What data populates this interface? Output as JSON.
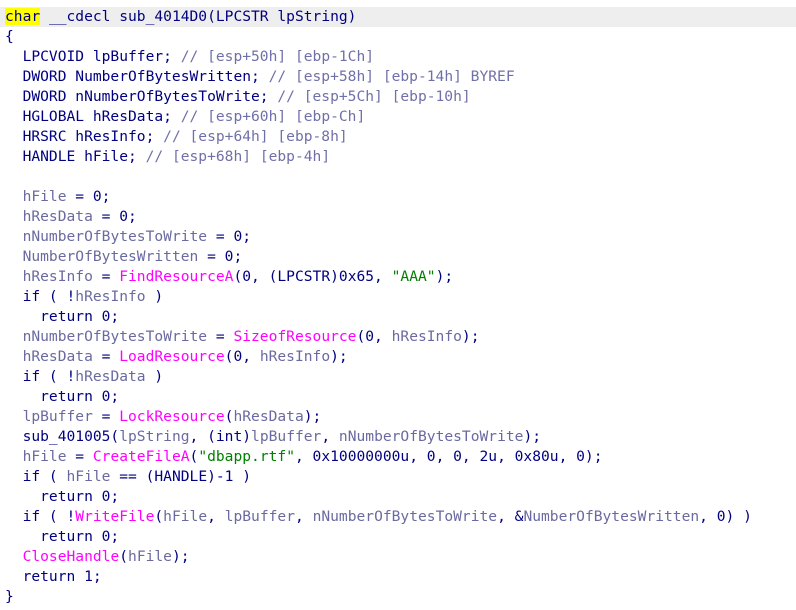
{
  "colors": {
    "background": "#ffffff",
    "default_text": "#000080",
    "local_var": "#6a6aa0",
    "api_call": "#ff00ff",
    "string_literal": "#008000",
    "comment": "#7070a8",
    "cursor_highlight": "#ffff00",
    "current_line": "#eeeeee"
  },
  "lines": [
    [
      {
        "t": "char",
        "c": "cursor"
      },
      {
        "t": " __cdecl sub_4014D0(LPCSTR lpString)",
        "c": "kw"
      }
    ],
    [
      {
        "t": "{",
        "c": "kw"
      }
    ],
    [
      {
        "t": "  LPCVOID lpBuffer; ",
        "c": "kw"
      },
      {
        "t": "// [esp+50h] [ebp-1Ch]",
        "c": "com"
      }
    ],
    [
      {
        "t": "  DWORD NumberOfBytesWritten; ",
        "c": "kw"
      },
      {
        "t": "// [esp+58h] [ebp-14h] BYREF",
        "c": "com"
      }
    ],
    [
      {
        "t": "  DWORD nNumberOfBytesToWrite; ",
        "c": "kw"
      },
      {
        "t": "// [esp+5Ch] [ebp-10h]",
        "c": "com"
      }
    ],
    [
      {
        "t": "  HGLOBAL hResData; ",
        "c": "kw"
      },
      {
        "t": "// [esp+60h] [ebp-Ch]",
        "c": "com"
      }
    ],
    [
      {
        "t": "  HRSRC hResInfo; ",
        "c": "kw"
      },
      {
        "t": "// [esp+64h] [ebp-8h]",
        "c": "com"
      }
    ],
    [
      {
        "t": "  HANDLE hFile; ",
        "c": "kw"
      },
      {
        "t": "// [esp+68h] [ebp-4h]",
        "c": "com"
      }
    ],
    [],
    [
      {
        "t": "  ",
        "c": "kw"
      },
      {
        "t": "hFile",
        "c": "var"
      },
      {
        "t": " = 0;",
        "c": "kw"
      }
    ],
    [
      {
        "t": "  ",
        "c": "kw"
      },
      {
        "t": "hResData",
        "c": "var"
      },
      {
        "t": " = 0;",
        "c": "kw"
      }
    ],
    [
      {
        "t": "  ",
        "c": "kw"
      },
      {
        "t": "nNumberOfBytesToWrite",
        "c": "var"
      },
      {
        "t": " = 0;",
        "c": "kw"
      }
    ],
    [
      {
        "t": "  ",
        "c": "kw"
      },
      {
        "t": "NumberOfBytesWritten",
        "c": "var"
      },
      {
        "t": " = 0;",
        "c": "kw"
      }
    ],
    [
      {
        "t": "  ",
        "c": "kw"
      },
      {
        "t": "hResInfo",
        "c": "var"
      },
      {
        "t": " = ",
        "c": "kw"
      },
      {
        "t": "FindResourceA",
        "c": "fn"
      },
      {
        "t": "(0, (LPCSTR)0x65, ",
        "c": "kw"
      },
      {
        "t": "\"AAA\"",
        "c": "str"
      },
      {
        "t": ");",
        "c": "kw"
      }
    ],
    [
      {
        "t": "  if ( !",
        "c": "kw"
      },
      {
        "t": "hResInfo",
        "c": "var"
      },
      {
        "t": " )",
        "c": "kw"
      }
    ],
    [
      {
        "t": "    return 0;",
        "c": "kw"
      }
    ],
    [
      {
        "t": "  ",
        "c": "kw"
      },
      {
        "t": "nNumberOfBytesToWrite",
        "c": "var"
      },
      {
        "t": " = ",
        "c": "kw"
      },
      {
        "t": "SizeofResource",
        "c": "fn"
      },
      {
        "t": "(0, ",
        "c": "kw"
      },
      {
        "t": "hResInfo",
        "c": "var"
      },
      {
        "t": ");",
        "c": "kw"
      }
    ],
    [
      {
        "t": "  ",
        "c": "kw"
      },
      {
        "t": "hResData",
        "c": "var"
      },
      {
        "t": " = ",
        "c": "kw"
      },
      {
        "t": "LoadResource",
        "c": "fn"
      },
      {
        "t": "(0, ",
        "c": "kw"
      },
      {
        "t": "hResInfo",
        "c": "var"
      },
      {
        "t": ");",
        "c": "kw"
      }
    ],
    [
      {
        "t": "  if ( !",
        "c": "kw"
      },
      {
        "t": "hResData",
        "c": "var"
      },
      {
        "t": " )",
        "c": "kw"
      }
    ],
    [
      {
        "t": "    return 0;",
        "c": "kw"
      }
    ],
    [
      {
        "t": "  ",
        "c": "kw"
      },
      {
        "t": "lpBuffer",
        "c": "var"
      },
      {
        "t": " = ",
        "c": "kw"
      },
      {
        "t": "LockResource",
        "c": "fn"
      },
      {
        "t": "(",
        "c": "kw"
      },
      {
        "t": "hResData",
        "c": "var"
      },
      {
        "t": ");",
        "c": "kw"
      }
    ],
    [
      {
        "t": "  sub_401005(",
        "c": "kw"
      },
      {
        "t": "lpString",
        "c": "var"
      },
      {
        "t": ", (int)",
        "c": "kw"
      },
      {
        "t": "lpBuffer",
        "c": "var"
      },
      {
        "t": ", ",
        "c": "kw"
      },
      {
        "t": "nNumberOfBytesToWrite",
        "c": "var"
      },
      {
        "t": ");",
        "c": "kw"
      }
    ],
    [
      {
        "t": "  ",
        "c": "kw"
      },
      {
        "t": "hFile",
        "c": "var"
      },
      {
        "t": " = ",
        "c": "kw"
      },
      {
        "t": "CreateFileA",
        "c": "fn"
      },
      {
        "t": "(",
        "c": "kw"
      },
      {
        "t": "\"dbapp.rtf\"",
        "c": "str"
      },
      {
        "t": ", 0x10000000u, 0, 0, 2u, 0x80u, 0);",
        "c": "kw"
      }
    ],
    [
      {
        "t": "  if ( ",
        "c": "kw"
      },
      {
        "t": "hFile",
        "c": "var"
      },
      {
        "t": " == (HANDLE)-1 )",
        "c": "kw"
      }
    ],
    [
      {
        "t": "    return 0;",
        "c": "kw"
      }
    ],
    [
      {
        "t": "  if ( !",
        "c": "kw"
      },
      {
        "t": "WriteFile",
        "c": "fn"
      },
      {
        "t": "(",
        "c": "kw"
      },
      {
        "t": "hFile",
        "c": "var"
      },
      {
        "t": ", ",
        "c": "kw"
      },
      {
        "t": "lpBuffer",
        "c": "var"
      },
      {
        "t": ", ",
        "c": "kw"
      },
      {
        "t": "nNumberOfBytesToWrite",
        "c": "var"
      },
      {
        "t": ", &",
        "c": "kw"
      },
      {
        "t": "NumberOfBytesWritten",
        "c": "var"
      },
      {
        "t": ", 0) )",
        "c": "kw"
      }
    ],
    [
      {
        "t": "    return 0;",
        "c": "kw"
      }
    ],
    [
      {
        "t": "  ",
        "c": "kw"
      },
      {
        "t": "CloseHandle",
        "c": "fn"
      },
      {
        "t": "(",
        "c": "kw"
      },
      {
        "t": "hFile",
        "c": "var"
      },
      {
        "t": ");",
        "c": "kw"
      }
    ],
    [
      {
        "t": "  return 1;",
        "c": "kw"
      }
    ],
    [
      {
        "t": "}",
        "c": "kw"
      }
    ]
  ]
}
